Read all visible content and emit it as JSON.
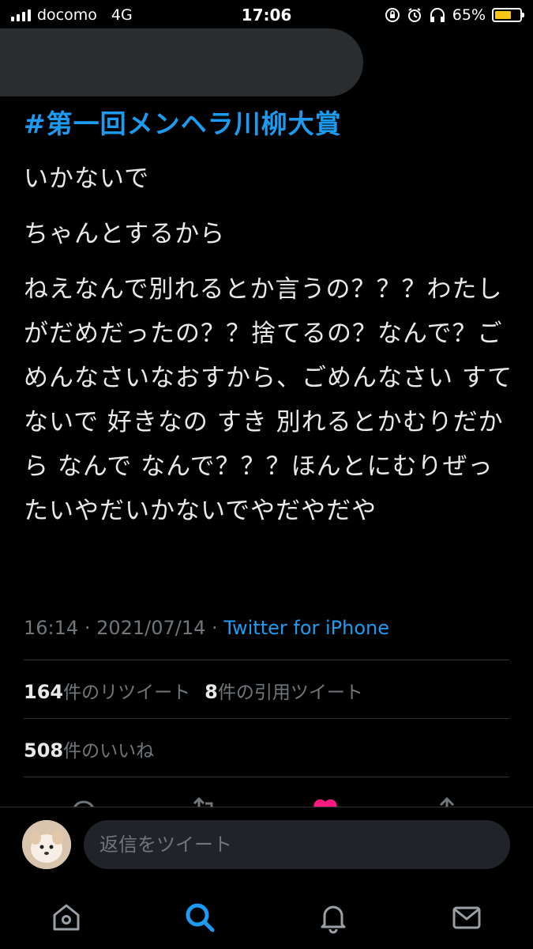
{
  "status_bar": {
    "carrier": "docomo",
    "network": "4G",
    "time": "17:06",
    "battery_percent": "65%",
    "battery_level": 0.65,
    "icons": [
      "signal-icon",
      "orientation-lock-icon",
      "alarm-icon",
      "headphones-icon",
      "battery-icon"
    ]
  },
  "tweet": {
    "hashtag": "#第一回メンヘラ川柳大賞",
    "paragraphs": [
      "いかないで",
      "ちゃんとするから",
      "ねえなんで別れるとか言うの？？？わたしがだめだったの？？捨てるの？なんで？ごめんなさいなおすから、ごめんなさい すてないで 好きなの すき 別れるとかむりだから なんで なんで？？？ほんとにむりぜったいやだいかないでやだやだや"
    ],
    "time": "16:14",
    "date": "2021/07/14",
    "source": "Twitter for iPhone"
  },
  "stats": {
    "retweets_count": "164",
    "retweets_label": "件のリツイート",
    "quotes_count": "8",
    "quotes_label": "件の引用ツイート",
    "likes_count": "508",
    "likes_label": "件のいいね"
  },
  "actions": {
    "icons": [
      "reply-icon",
      "retweet-icon",
      "like-icon",
      "share-icon"
    ],
    "like_color": "#f91880"
  },
  "composer": {
    "placeholder": "返信をツイート"
  },
  "bottom_nav": {
    "items": [
      "home-icon",
      "search-icon",
      "notifications-icon",
      "messages-icon"
    ],
    "active": "search-icon",
    "accent": "#1d9bf0"
  }
}
